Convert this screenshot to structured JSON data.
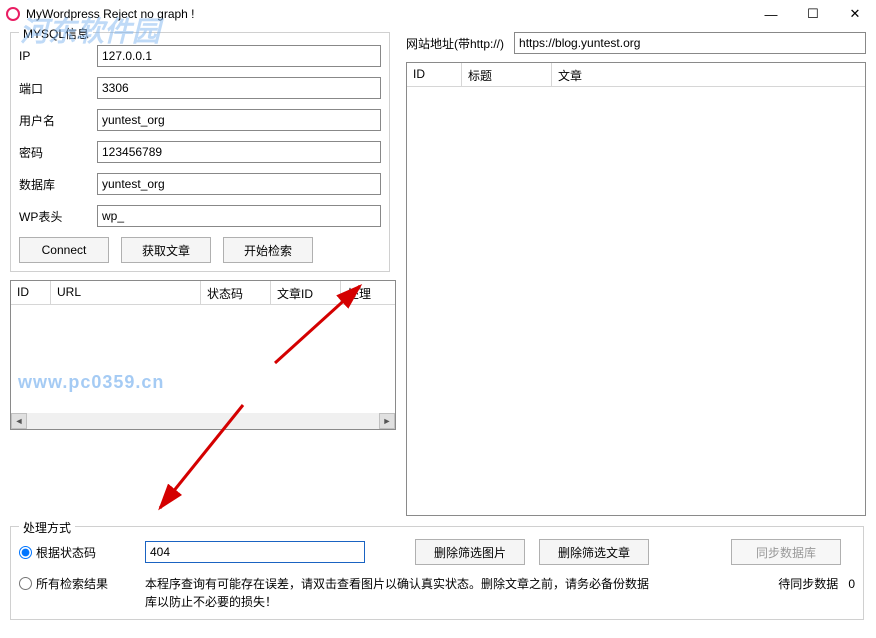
{
  "window": {
    "title": "MyWordpress Reject no graph !",
    "min": "—",
    "max": "☐",
    "close": "✕"
  },
  "mysql": {
    "group_title": "MYSQL信息",
    "ip_label": "IP",
    "ip_value": "127.0.0.1",
    "port_label": "端口",
    "port_value": "3306",
    "user_label": "用户名",
    "user_value": "yuntest_org",
    "pwd_label": "密码",
    "pwd_value": "123456789",
    "db_label": "数据库",
    "db_value": "yuntest_org",
    "prefix_label": "WP表头",
    "prefix_value": "wp_",
    "connect_btn": "Connect",
    "fetch_btn": "获取文章",
    "search_btn": "开始检索"
  },
  "site": {
    "addr_label": "网站地址(带http://)",
    "addr_value": "https://blog.yuntest.org"
  },
  "list_left": {
    "cols": [
      "ID",
      "URL",
      "状态码",
      "文章ID",
      "处理"
    ]
  },
  "list_right": {
    "cols": [
      "ID",
      "标题",
      "文章"
    ]
  },
  "process": {
    "group_title": "处理方式",
    "radio_status": "根据状态码",
    "status_value": "404",
    "radio_all": "所有检索结果",
    "del_img_btn": "删除筛选图片",
    "del_article_btn": "删除筛选文章",
    "sync_btn": "同步数据库",
    "help_text": "本程序查询有可能存在误差，请双击查看图片以确认真实状态。删除文章之前，请务必备份数据库以防止不必要的损失！",
    "sync_label": "待同步数据",
    "sync_count": "0"
  },
  "watermark": {
    "w1": "河东软件园",
    "w2": "www.pc0359.cn"
  }
}
